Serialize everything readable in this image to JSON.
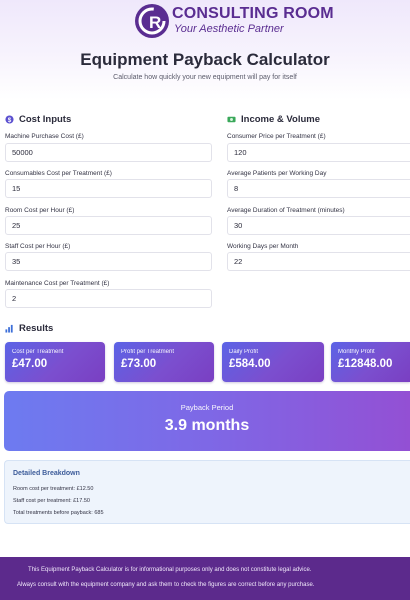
{
  "brand": {
    "logo_letter": "R",
    "name": "CONSULTING ROOM",
    "tagline": "Your Aesthetic Partner"
  },
  "page": {
    "title": "Equipment Payback Calculator",
    "subtitle": "Calculate how quickly your new equipment will pay for itself"
  },
  "cost_inputs": {
    "heading": "Cost Inputs",
    "icon": "dollar-circle-icon",
    "fields": [
      {
        "label": "Machine Purchase Cost (£)",
        "value": "50000"
      },
      {
        "label": "Consumables Cost per Treatment (£)",
        "value": "15"
      },
      {
        "label": "Room Cost per Hour (£)",
        "value": "25"
      },
      {
        "label": "Staff Cost per Hour (£)",
        "value": "35"
      },
      {
        "label": "Maintenance Cost per Treatment (£)",
        "value": "2"
      }
    ]
  },
  "income_volume": {
    "heading": "Income & Volume",
    "icon": "money-icon",
    "fields": [
      {
        "label": "Consumer Price per Treatment (£)",
        "value": "120"
      },
      {
        "label": "Average Patients per Working Day",
        "value": "8"
      },
      {
        "label": "Average Duration of Treatment (minutes)",
        "value": "30"
      },
      {
        "label": "Working Days per Month",
        "value": "22"
      }
    ]
  },
  "results": {
    "heading": "Results",
    "icon": "bar-chart-icon",
    "cards": [
      {
        "label": "Cost per Treatment",
        "value": "£47.00"
      },
      {
        "label": "Profit per Treatment",
        "value": "£73.00"
      },
      {
        "label": "Daily Profit",
        "value": "£584.00"
      },
      {
        "label": "Monthly Profit",
        "value": "£12848.00"
      }
    ],
    "payback_label": "Payback Period",
    "payback_value": "3.9 months"
  },
  "breakdown": {
    "title": "Detailed Breakdown",
    "lines": [
      "Room cost per treatment: £12.50",
      "Staff cost per treatment: £17.50",
      "Total treatments before payback: 685"
    ]
  },
  "footer": {
    "line1": "This Equipment Payback Calculator is for informational purposes only and does not constitute legal advice.",
    "line2": "Always consult with the equipment company and ask them to check the figures are correct before any purchase."
  },
  "colors": {
    "brand_purple": "#5a2d91",
    "card_gradient_start": "#5b63e6",
    "card_gradient_end": "#7a3fc2",
    "footer_bg": "#5c2a8c"
  }
}
